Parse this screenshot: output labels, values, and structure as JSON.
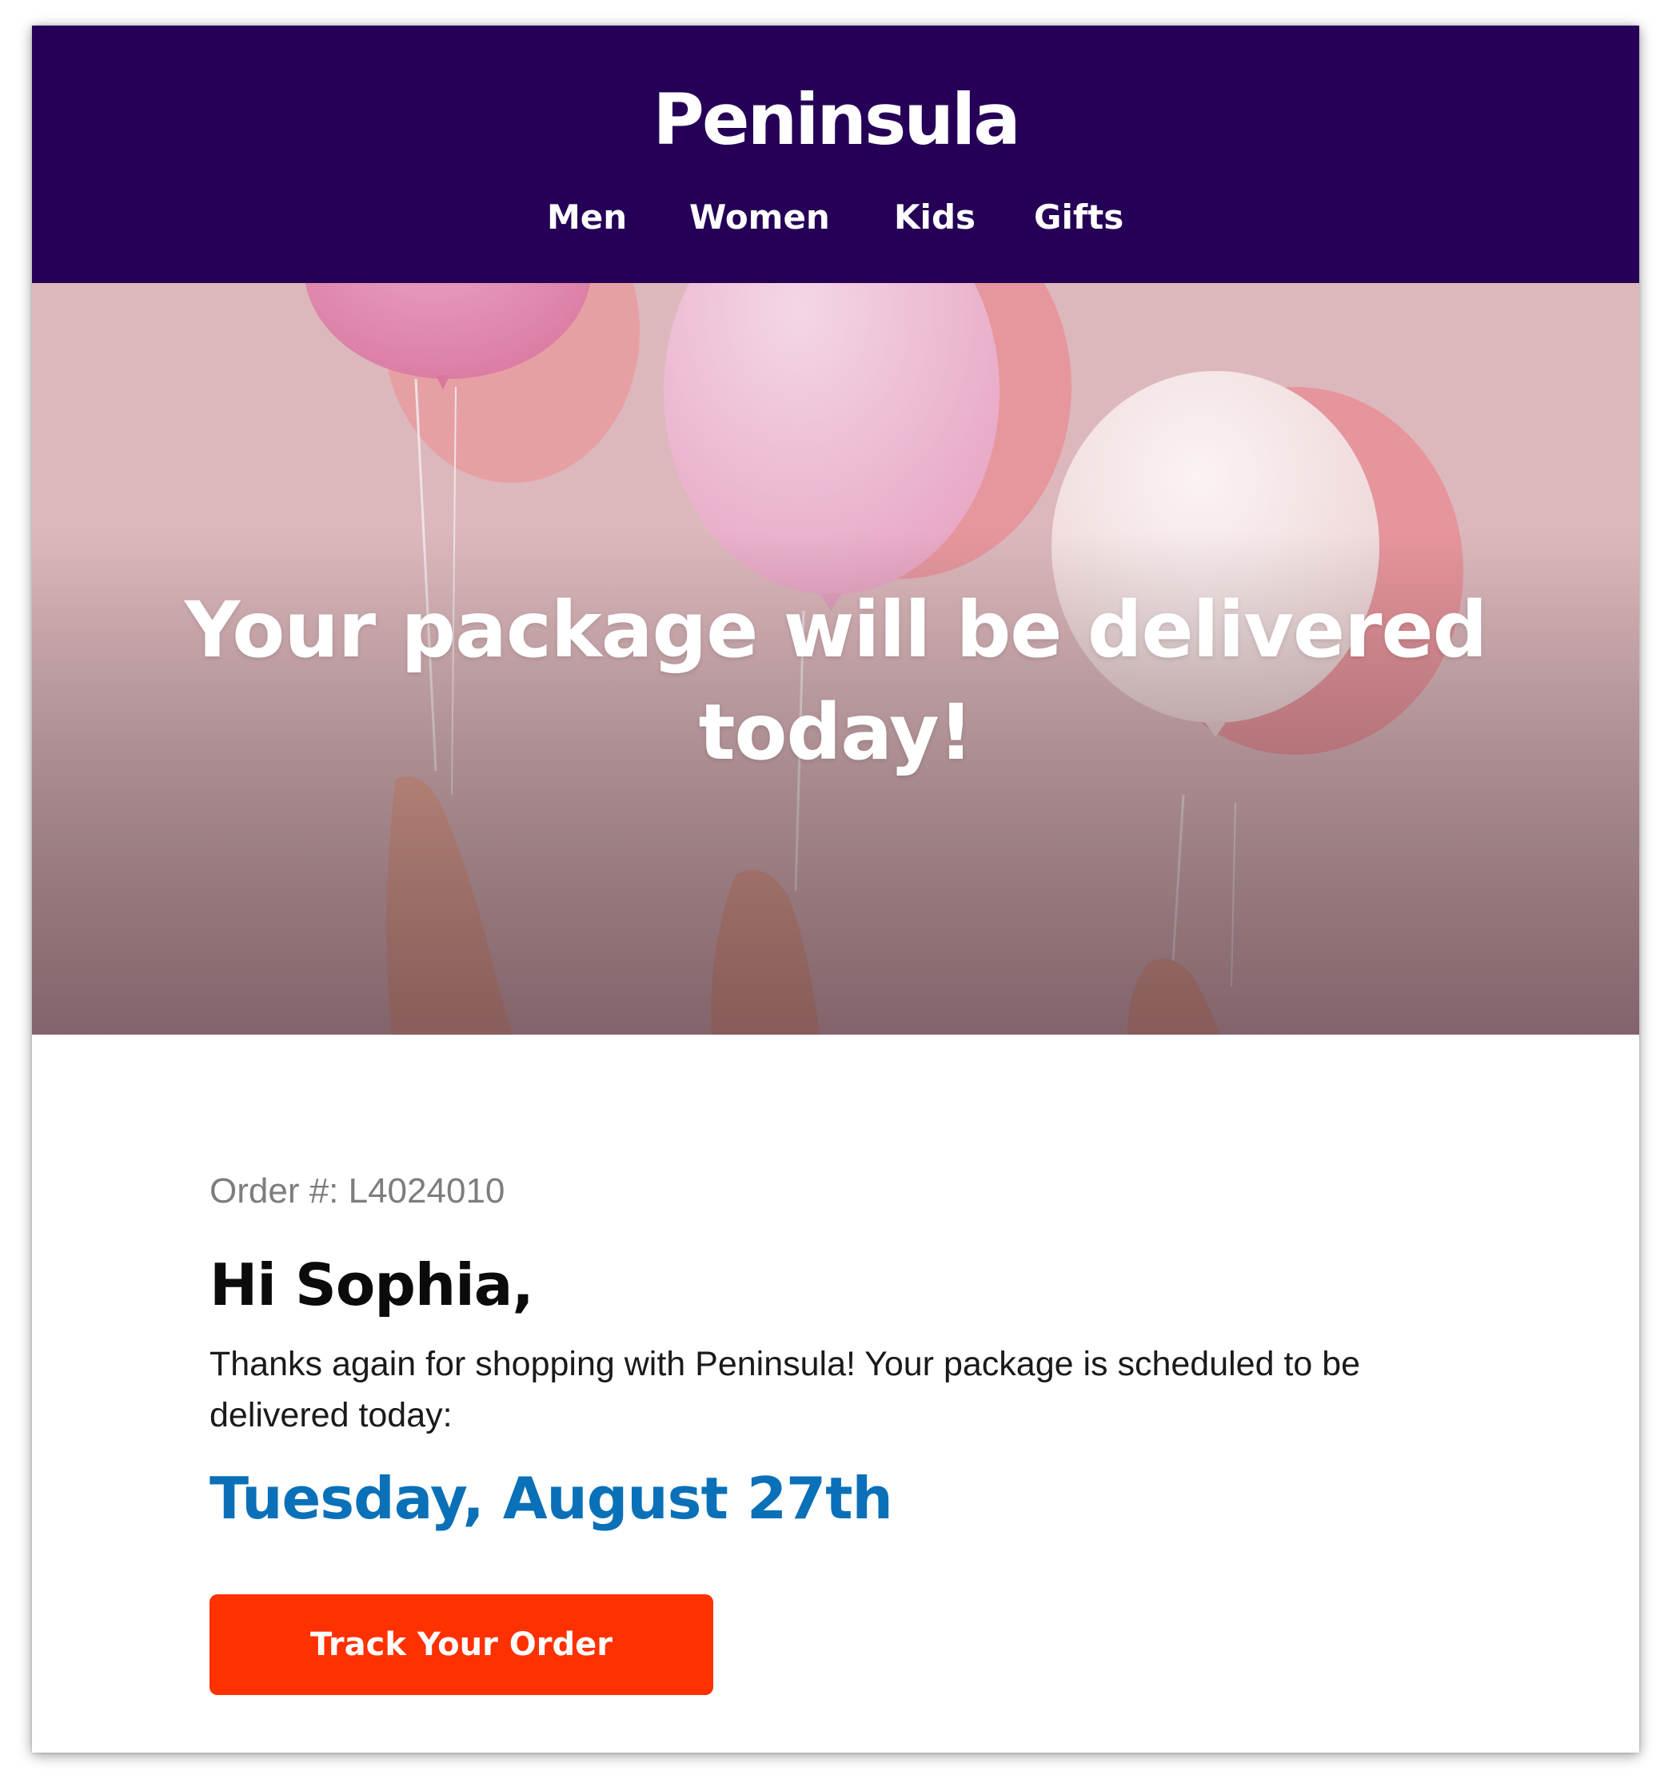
{
  "header": {
    "logo": "Peninsula",
    "nav": [
      {
        "label": "Men"
      },
      {
        "label": "Women"
      },
      {
        "label": "Kids"
      },
      {
        "label": "Gifts"
      }
    ]
  },
  "hero": {
    "title": "Your package will be delivered today!",
    "image": "pink-balloons-held-by-hands"
  },
  "body": {
    "order_number": "Order #: L4024010",
    "greeting": "Hi Sophia,",
    "message": "Thanks again for shopping with Peninsula! Your package is scheduled to be delivered today:",
    "delivery_date": "Tuesday, August 27th",
    "track_button": "Track Your Order"
  },
  "colors": {
    "header_bg": "#250056",
    "date_text": "#0a70b8",
    "button_bg": "#ff3100"
  }
}
